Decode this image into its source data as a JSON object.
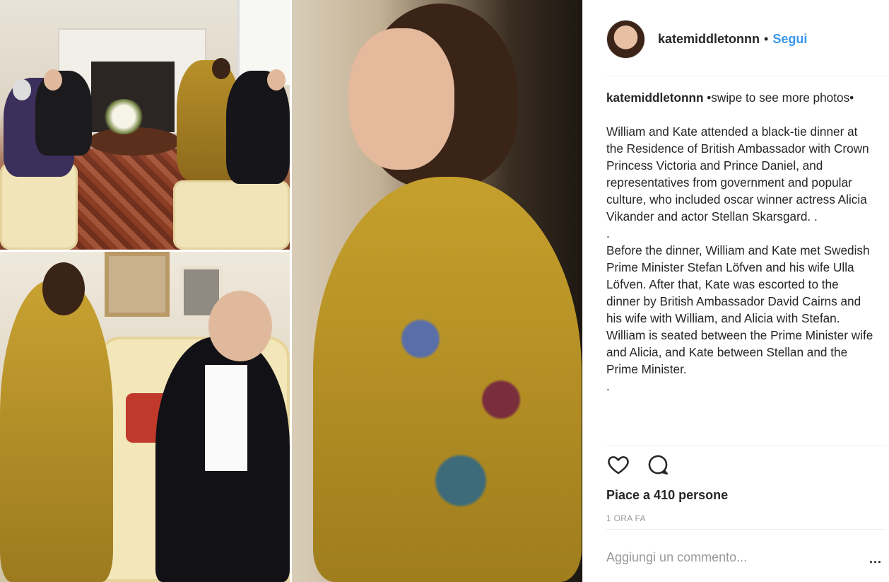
{
  "header": {
    "username": "katemiddletonnn",
    "separator": "•",
    "follow_label": "Segui",
    "avatar_icon": "profile-avatar"
  },
  "caption": {
    "username": "katemiddletonnn",
    "paragraphs": [
      " •swipe to see more photos•",
      "William and Kate attended a black-tie dinner at the Residence of British Ambassador with Crown Princess Victoria and Prince Daniel, and representatives from government and popular culture, who included oscar winner actress Alicia Vikander and actor Stellan Skarsgard. .",
      ".",
      "Before the dinner, William and Kate met Swedish Prime Minister Stefan Löfven and his wife Ulla Löfven. After that, Kate was escorted to the dinner by British Ambassador David Cairns and his wife with William, and Alicia with Stefan. William is seated between the Prime Minister wife and Alicia, and Kate between Stellan and the Prime Minister.",
      "."
    ]
  },
  "actions": {
    "like_icon": "heart-icon",
    "comment_icon": "comment-icon"
  },
  "likes_text": "Piace a 410 persone",
  "time_text": "1 ORA FA",
  "comment_placeholder": "Aggiungi un commento...",
  "more_label": "..."
}
